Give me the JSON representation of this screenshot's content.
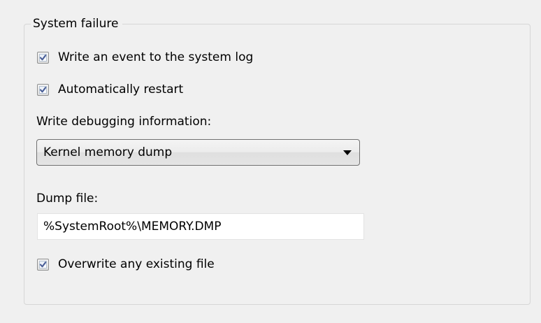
{
  "group": {
    "title": "System failure"
  },
  "options": {
    "write_event": {
      "label": "Write an event to the system log",
      "checked": true
    },
    "auto_restart": {
      "label": "Automatically restart",
      "checked": true
    },
    "overwrite_file": {
      "label": "Overwrite any existing file",
      "checked": true
    }
  },
  "debugging": {
    "label": "Write debugging information:",
    "selected": "Kernel memory dump"
  },
  "dump_file": {
    "label": "Dump file:",
    "value": "%SystemRoot%\\MEMORY.DMP"
  },
  "icons": {
    "check": "checkmark-icon",
    "dropdown": "dropdown-arrow-icon"
  },
  "colors": {
    "checkmark": "#4a5f97",
    "panel_background": "#f0f0f0"
  }
}
